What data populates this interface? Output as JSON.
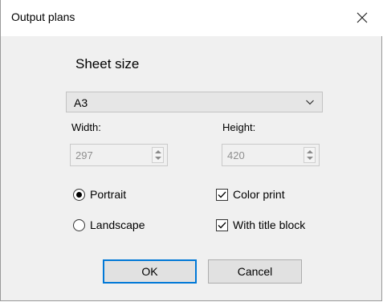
{
  "window": {
    "title": "Output plans"
  },
  "sheet": {
    "label": "Sheet size",
    "selected": "A3",
    "width_label": "Width:",
    "width_value": "297",
    "height_label": "Height:",
    "height_value": "420"
  },
  "orientation": {
    "portrait_label": "Portrait",
    "landscape_label": "Landscape",
    "selected": "Portrait"
  },
  "options": {
    "color_print_label": "Color print",
    "color_print_checked": true,
    "title_block_label": "With title block",
    "title_block_checked": true
  },
  "buttons": {
    "ok": "OK",
    "cancel": "Cancel"
  },
  "colors": {
    "accent": "#0078d7",
    "dialog_bg": "#f0f0f0"
  }
}
